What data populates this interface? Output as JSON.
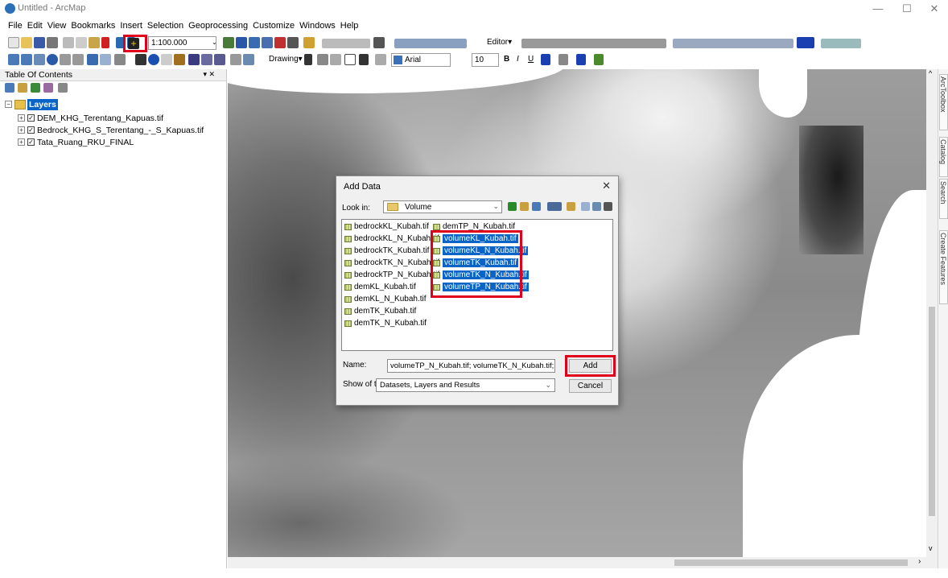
{
  "window": {
    "title": "Untitled - ArcMap",
    "minimize": "—",
    "maximize": "☐",
    "close": "✕"
  },
  "menu": [
    "File",
    "Edit",
    "View",
    "Bookmarks",
    "Insert",
    "Selection",
    "Geoprocessing",
    "Customize",
    "Windows",
    "Help"
  ],
  "toolbar": {
    "scale": "1:100.000",
    "editor_label": "Editor▾",
    "drawing_label": "Drawing▾",
    "font_name": "Arial",
    "font_size": "10",
    "bold": "B",
    "italic": "I",
    "underline": "U"
  },
  "toc": {
    "title": "Table Of Contents",
    "pin": "▾ ✕",
    "root": "Layers",
    "layers": [
      "DEM_KHG_Terentang_Kapuas.tif",
      "Bedrock_KHG_S_Terentang_-_S_Kapuas.tif",
      "Tata_Ruang_RKU_FINAL"
    ]
  },
  "sidetabs": [
    "ArcToolbox",
    "Catalog",
    "Search",
    "Create Features"
  ],
  "map_nav": {
    "buttons": "▣ ▤ ↻ ⏸ ‹",
    "right_arrow": "›",
    "scroll_up": "^",
    "scroll_down": "v"
  },
  "dialog": {
    "title": "Add Data",
    "close": "✕",
    "look_in_label": "Look in:",
    "look_in_value": "Volume",
    "files_col1": [
      "bedrockKL_Kubah.tif",
      "bedrockKL_N_Kubah.tif",
      "bedrockTK_Kubah.tif",
      "bedrockTK_N_Kubah.tif",
      "bedrockTP_N_Kubah.tif",
      "demKL_Kubah.tif",
      "demKL_N_Kubah.tif",
      "demTK_Kubah.tif",
      "demTK_N_Kubah.tif"
    ],
    "files_col2": [
      "demTP_N_Kubah.tif",
      "volumeKL_Kubah.tif",
      "volumeKL_N_Kubah.tif",
      "volumeTK_Kubah.tif",
      "volumeTK_N_Kubah.tif",
      "volumeTP_N_Kubah.tif"
    ],
    "selected_col2": [
      false,
      true,
      true,
      true,
      true,
      true
    ],
    "name_label": "Name:",
    "name_value": "volumeTP_N_Kubah.tif; volumeTK_N_Kubah.tif; volumeTK",
    "type_label": "Show of type:",
    "type_value": "Datasets, Layers and Results",
    "add_button": "Add",
    "cancel_button": "Cancel"
  },
  "colors": {
    "highlight": "#e0001b",
    "selection": "#0a64c8"
  }
}
